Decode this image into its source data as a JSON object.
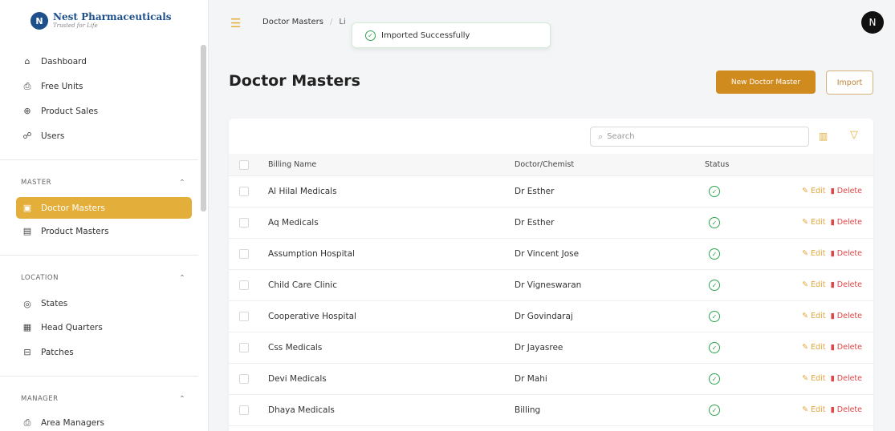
{
  "brand": {
    "name": "Nest Pharmaceuticals",
    "tagline": "Trusted for Life",
    "logo_letter": "N"
  },
  "sidebar": {
    "main_items": [
      {
        "label": "Dashboard",
        "icon": "home-icon"
      },
      {
        "label": "Free Units",
        "icon": "printer-icon"
      },
      {
        "label": "Product Sales",
        "icon": "product-sales-icon"
      },
      {
        "label": "Users",
        "icon": "users-icon"
      }
    ],
    "sections": [
      {
        "title": "MASTER",
        "items": [
          {
            "label": "Doctor Masters",
            "icon": "clipboard-icon",
            "active": true
          },
          {
            "label": "Product Masters",
            "icon": "product-icon"
          }
        ]
      },
      {
        "title": "LOCATION",
        "items": [
          {
            "label": "States",
            "icon": "globe-icon"
          },
          {
            "label": "Head Quarters",
            "icon": "building-icon"
          },
          {
            "label": "Patches",
            "icon": "patch-icon"
          }
        ]
      },
      {
        "title": "MANAGER",
        "items": [
          {
            "label": "Area Managers",
            "icon": "printer-icon"
          }
        ]
      }
    ]
  },
  "topbar": {
    "breadcrumb": [
      "Doctor Masters",
      "Li"
    ],
    "avatar_letter": "N",
    "toast": "Imported Successfully"
  },
  "page": {
    "title": "Doctor Masters",
    "new_button": "New Doctor Master",
    "import_button": "Import",
    "search_placeholder": "Search"
  },
  "table": {
    "columns": [
      "Billing Name",
      "Doctor/Chemist",
      "Status"
    ],
    "edit_label": "Edit",
    "delete_label": "Delete",
    "rows": [
      {
        "billing_name": "Al Hilal Medicals",
        "doctor": "Dr Esther",
        "status": "active"
      },
      {
        "billing_name": "Aq Medicals",
        "doctor": "Dr Esther",
        "status": "active"
      },
      {
        "billing_name": "Assumption Hospital",
        "doctor": "Dr Vincent Jose",
        "status": "active"
      },
      {
        "billing_name": "Child Care Clinic",
        "doctor": "Dr Vigneswaran",
        "status": "active"
      },
      {
        "billing_name": "Cooperative Hospital",
        "doctor": "Dr Govindaraj",
        "status": "active"
      },
      {
        "billing_name": "Css Medicals",
        "doctor": "Dr Jayasree",
        "status": "active"
      },
      {
        "billing_name": "Devi Medicals",
        "doctor": "Dr Mahi",
        "status": "active"
      },
      {
        "billing_name": "Dhaya Medicals",
        "doctor": "Billing",
        "status": "active"
      }
    ]
  },
  "colors": {
    "accent": "#e3ae3a",
    "primary_button": "#d08b1e",
    "success": "#2ea44f",
    "danger": "#e04444",
    "brand": "#1d4f8a"
  }
}
